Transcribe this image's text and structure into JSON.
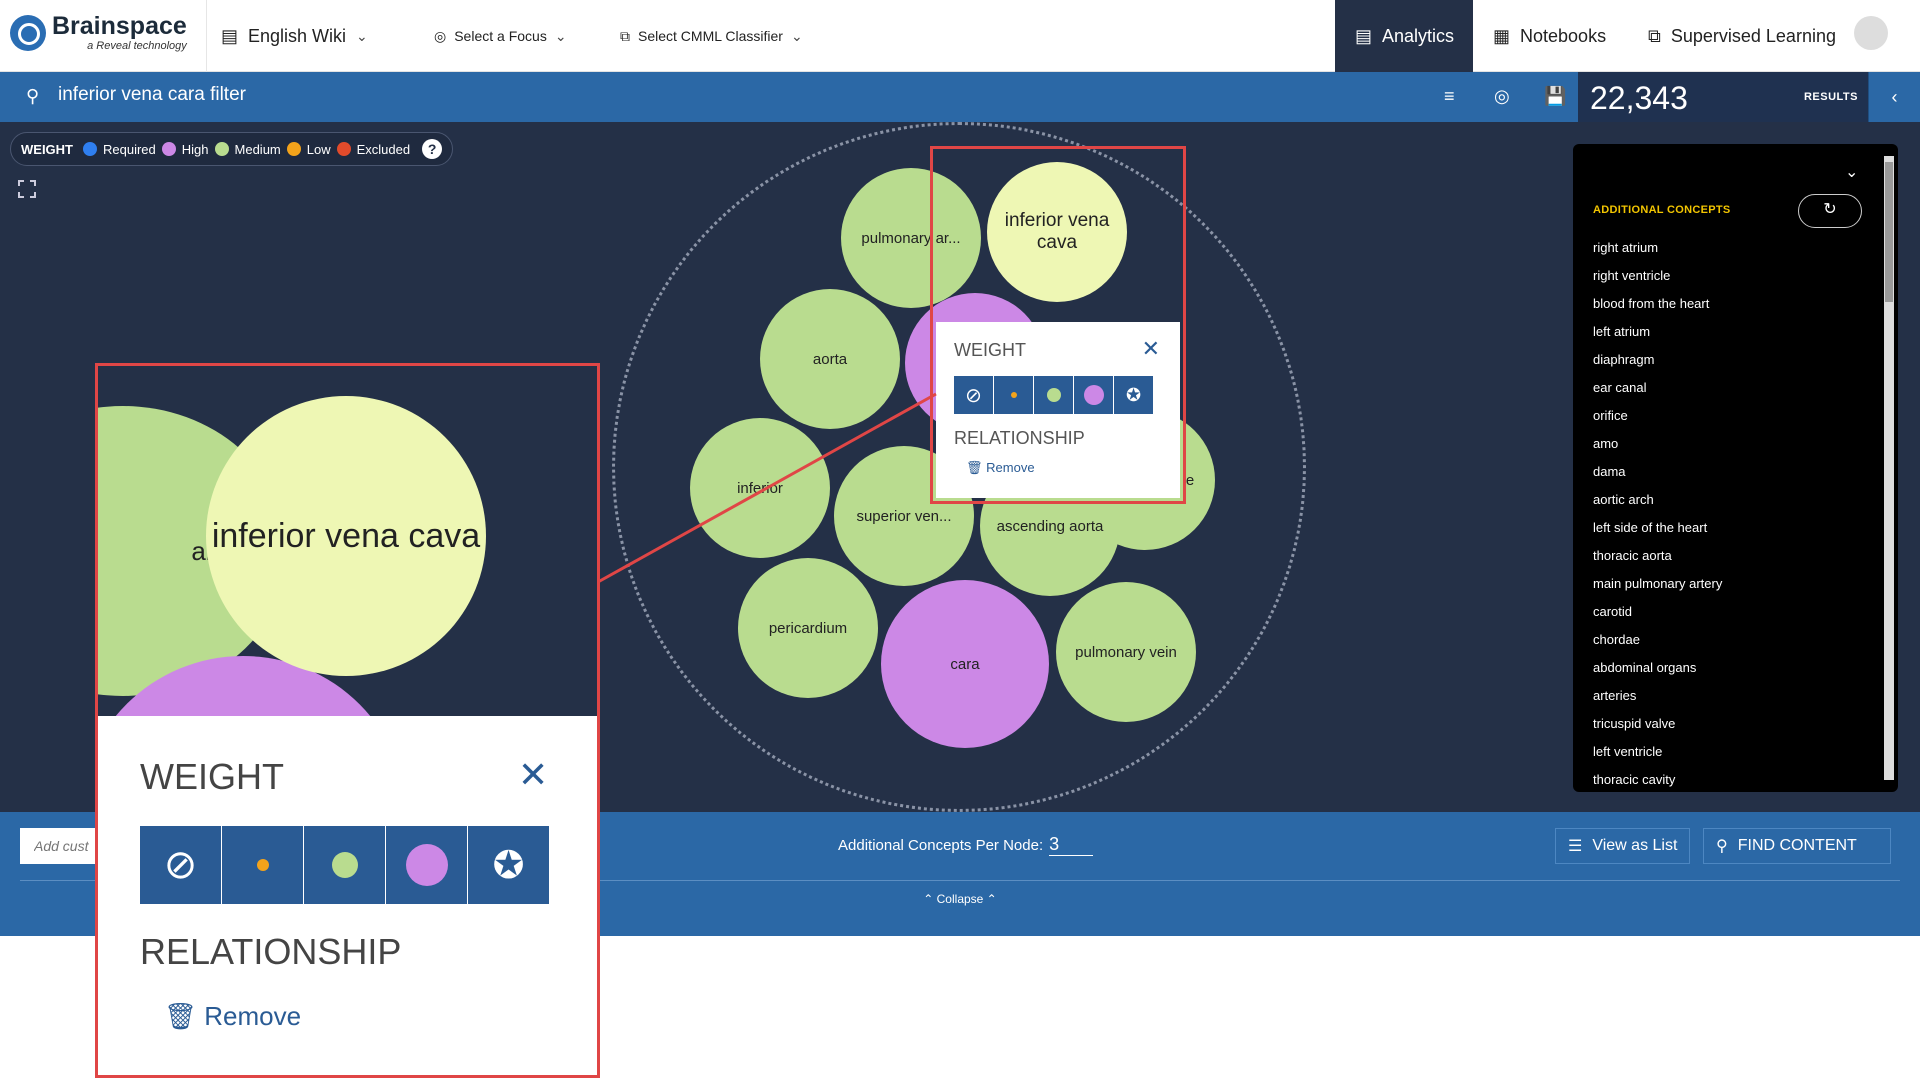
{
  "app": {
    "name": "Brainspace",
    "tagline": "a Reveal technology"
  },
  "header": {
    "dataset": "English Wiki",
    "focus": "Select a Focus",
    "classifier": "Select CMML Classifier",
    "tabs": [
      {
        "label": "Analytics",
        "active": true
      },
      {
        "label": "Notebooks"
      },
      {
        "label": "Supervised Learning"
      }
    ]
  },
  "search": {
    "query": "inferior vena cara filter",
    "results_count": "22,343",
    "results_label": "RESULTS"
  },
  "legend": {
    "title": "WEIGHT",
    "items": [
      {
        "label": "Required",
        "color": "#2f7ff0"
      },
      {
        "label": "High",
        "color": "#cc88e6"
      },
      {
        "label": "Medium",
        "color": "#b9dc8f"
      },
      {
        "label": "Low",
        "color": "#f3a31b"
      },
      {
        "label": "Excluded",
        "color": "#e24b2b"
      }
    ],
    "help": "?"
  },
  "nodes": [
    {
      "label": "pulmonary ar...",
      "weight": "medium"
    },
    {
      "label": "inferior vena cava",
      "weight": "focused"
    },
    {
      "label": "aorta",
      "weight": "medium"
    },
    {
      "label": "",
      "weight": "high"
    },
    {
      "label": "e",
      "weight": "medium"
    },
    {
      "label": "inferior",
      "weight": "medium"
    },
    {
      "label": "superior ven...",
      "weight": "medium"
    },
    {
      "label": "ascending aorta",
      "weight": "medium"
    },
    {
      "label": "pericardium",
      "weight": "medium"
    },
    {
      "label": "cara",
      "weight": "high"
    },
    {
      "label": "pulmonary vein",
      "weight": "medium"
    }
  ],
  "popup": {
    "weight_title": "WEIGHT",
    "relationship_title": "RELATIONSHIP",
    "remove_label": "Remove"
  },
  "sidebar": {
    "title": "ADDITIONAL CONCEPTS",
    "items": [
      "right atrium",
      "right ventricle",
      "blood from the heart",
      "left atrium",
      "diaphragm",
      "ear canal",
      "orifice",
      "amo",
      "dama",
      "aortic arch",
      "left side of the heart",
      "thoracic aorta",
      "main pulmonary artery",
      "carotid",
      "chordae",
      "abdominal organs",
      "arteries",
      "tricuspid valve",
      "left ventricle",
      "thoracic cavity"
    ]
  },
  "bottom": {
    "add_placeholder": "Add cust",
    "apn_label": "Additional Concepts Per Node:",
    "apn_value": "3",
    "view_list": "View as List",
    "find_content": "FIND CONTENT",
    "collapse": "Collapse"
  }
}
